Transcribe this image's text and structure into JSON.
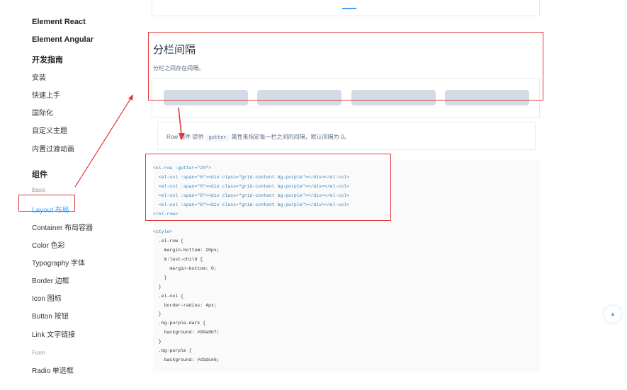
{
  "sidebar": {
    "items": [
      {
        "label": "Element React",
        "kind": "bold"
      },
      {
        "label": "Element Angular",
        "kind": "bold"
      },
      {
        "label": "开发指南",
        "kind": "bold"
      },
      {
        "label": "安装",
        "kind": "link"
      },
      {
        "label": "快速上手",
        "kind": "link"
      },
      {
        "label": "国际化",
        "kind": "link"
      },
      {
        "label": "自定义主题",
        "kind": "link"
      },
      {
        "label": "内置过渡动画",
        "kind": "link"
      },
      {
        "label": "组件",
        "kind": "bold"
      },
      {
        "label": "Basic",
        "kind": "group"
      },
      {
        "label": "Layout 布局",
        "kind": "active"
      },
      {
        "label": "Container 布局容器",
        "kind": "link"
      },
      {
        "label": "Color 色彩",
        "kind": "link"
      },
      {
        "label": "Typography 字体",
        "kind": "link"
      },
      {
        "label": "Border 边框",
        "kind": "link"
      },
      {
        "label": "Icon 图标",
        "kind": "link"
      },
      {
        "label": "Button 按钮",
        "kind": "link"
      },
      {
        "label": "Link 文字链接",
        "kind": "link"
      },
      {
        "label": "Form",
        "kind": "group"
      },
      {
        "label": "Radio 单选框",
        "kind": "link"
      }
    ]
  },
  "section": {
    "title": "分栏间隔",
    "description": "分栏之间存在间隔。"
  },
  "description": {
    "prefix": "Row 组件 提供",
    "code": "gutter",
    "suffix": "属性来指定每一栏之间的间隔，默认间隔为 0。"
  },
  "code": {
    "lines": [
      "<el-row :gutter=\"20\">",
      "  <el-col :span=\"6\"><div class=\"grid-content bg-purple\"></div></el-col>",
      "  <el-col :span=\"6\"><div class=\"grid-content bg-purple\"></div></el-col>",
      "  <el-col :span=\"6\"><div class=\"grid-content bg-purple\"></div></el-col>",
      "  <el-col :span=\"6\"><div class=\"grid-content bg-purple\"></div></el-col>",
      "</el-row>",
      "",
      "<style>",
      "  .el-row {",
      "    margin-bottom: 20px;",
      "    &:last-child {",
      "      margin-bottom: 0;",
      "    }",
      "  }",
      "  .el-col {",
      "    border-radius: 4px;",
      "  }",
      "  .bg-purple-dark {",
      "    background: #99a9bf;",
      "  }",
      "  .bg-purple {",
      "    background: #d3dce6;"
    ]
  },
  "colors": {
    "accent": "#409EFF",
    "grid_bg": "#d3dce6",
    "annotation_red": "#e23a3a"
  },
  "icons": {
    "back_to_top": "caret-up-icon",
    "back_to_top_glyph": "▲"
  }
}
